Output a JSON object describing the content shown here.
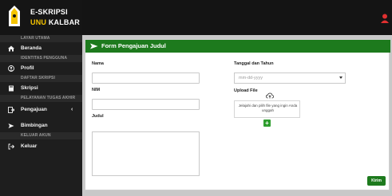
{
  "brand": {
    "line1": "E-SKRIPSI",
    "line2_accent": "UNU",
    "line2_white": "KALBAR"
  },
  "sidebar": {
    "sections": [
      {
        "header": "LAYAR UTAMA"
      },
      {
        "header": "IDENTITAS PENGGUNA"
      },
      {
        "header": "DAFTAR SKRIPSI"
      },
      {
        "header": "PELAYANAN TUGAS AKHIR"
      },
      {
        "header": "KELUAR AKUN"
      }
    ],
    "items": [
      {
        "label": "Beranda",
        "icon": "home-icon"
      },
      {
        "label": "Profil",
        "icon": "user-icon"
      },
      {
        "label": "Skripsi",
        "icon": "book-icon"
      },
      {
        "label": "Pengajuan",
        "icon": "submit-icon"
      },
      {
        "label": "Bimbingan",
        "icon": "send-icon"
      },
      {
        "label": "Keluar",
        "icon": "logout-icon"
      }
    ]
  },
  "form": {
    "title": "Form Pengajuan Judul",
    "fields": {
      "nama_label": "Nama",
      "nim_label": "NIM",
      "judul_label": "Judul",
      "tanggal_label": "Tanggal dan Tahun",
      "tanggal_placeholder": "mm-dd-yyyy",
      "upload_label": "Upload File",
      "upload_hint": "Jelajahi dan pilih file yang ingin Anda unggah"
    },
    "submit_label": "Kirim"
  },
  "colors": {
    "accent": "#1d7a1d",
    "brand_accent": "#f5c400"
  }
}
